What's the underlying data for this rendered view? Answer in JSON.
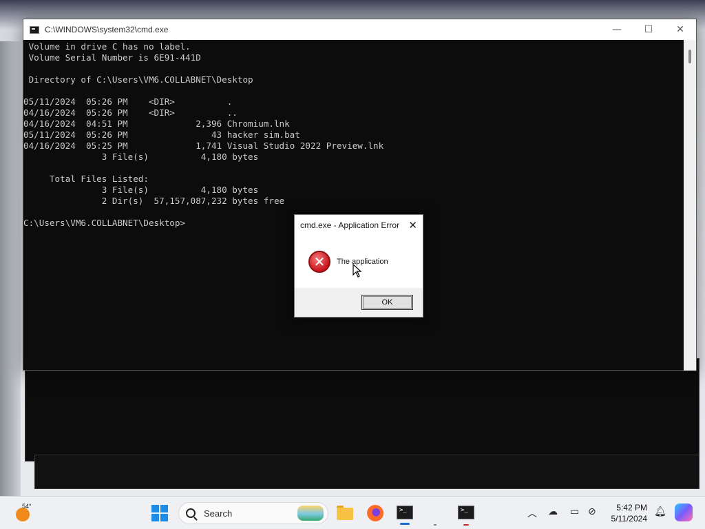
{
  "cmd_window": {
    "title": "C:\\WINDOWS\\system32\\cmd.exe",
    "lines": [
      " Volume in drive C has no label.",
      " Volume Serial Number is 6E91-441D",
      "",
      " Directory of C:\\Users\\VM6.COLLABNET\\Desktop",
      "",
      "05/11/2024  05:26 PM    <DIR>          .",
      "04/16/2024  05:26 PM    <DIR>          ..",
      "04/16/2024  04:51 PM             2,396 Chromium.lnk",
      "05/11/2024  05:26 PM                43 hacker sim.bat",
      "04/16/2024  05:25 PM             1,741 Visual Studio 2022 Preview.lnk",
      "               3 File(s)          4,180 bytes",
      "",
      "     Total Files Listed:",
      "               3 File(s)          4,180 bytes",
      "               2 Dir(s)  57,157,087,232 bytes free",
      "",
      "C:\\Users\\VM6.COLLABNET\\Desktop>"
    ]
  },
  "dialog": {
    "title": "cmd.exe - Application Error",
    "message": "The application",
    "ok_label": "OK"
  },
  "taskbar": {
    "weather_temp": "54°",
    "search_placeholder": "Search",
    "time": "5:42 PM",
    "date": "5/11/2024"
  }
}
